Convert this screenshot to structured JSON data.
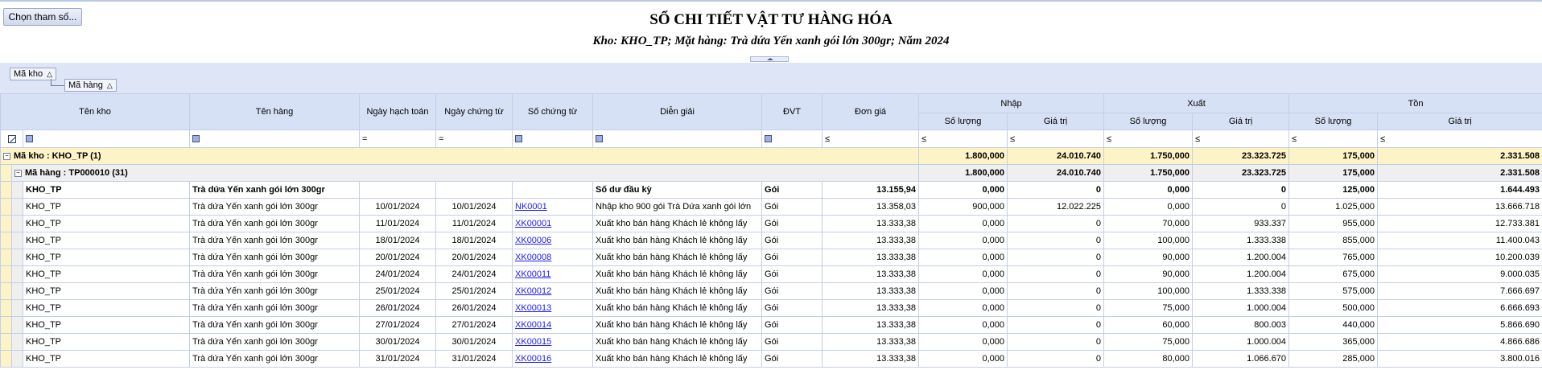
{
  "toolbar": {
    "choose_params_label": "Chọn tham số..."
  },
  "report": {
    "title": "SỔ CHI TIẾT VẬT TƯ HÀNG HÓA",
    "subtitle": "Kho: KHO_TP; Mặt hàng: Trà dứa Yến xanh gói lớn 300gr; Năm 2024"
  },
  "group_panel": {
    "chip1": "Mã kho",
    "chip2": "Mã hàng",
    "sort_icon": "sort-ascending-icon"
  },
  "columns": {
    "warehouse": "Tên kho",
    "item": "Tên hàng",
    "posting_date": "Ngày hạch toán",
    "voucher_date": "Ngày chứng từ",
    "voucher_no": "Số chứng từ",
    "description": "Diễn giải",
    "unit": "ĐVT",
    "unit_price": "Đơn giá",
    "in": "Nhập",
    "out": "Xuất",
    "stock": "Tồn",
    "qty": "Số lượng",
    "value": "Giá trị"
  },
  "filter_ops": {
    "eq": "=",
    "le": "≤"
  },
  "group_level1": {
    "label": "Mã kho : KHO_TP (1)",
    "in_qty": "1.800,000",
    "in_val": "24.010.740",
    "out_qty": "1.750,000",
    "out_val": "23.323.725",
    "stock_qty": "175,000",
    "stock_val": "2.331.508"
  },
  "group_level2": {
    "label": "Mã hàng : TP000010 (31)",
    "in_qty": "1.800,000",
    "in_val": "24.010.740",
    "out_qty": "1.750,000",
    "out_val": "23.323.725",
    "stock_qty": "175,000",
    "stock_val": "2.331.508"
  },
  "rows": [
    {
      "warehouse": "KHO_TP",
      "item": "Trà dứa Yến xanh gói lớn 300gr",
      "posting_date": "",
      "voucher_date": "",
      "voucher_no": "",
      "description": "Số dư đầu kỳ",
      "unit": "Gói",
      "unit_price": "13.155,94",
      "in_qty": "0,000",
      "in_val": "0",
      "out_qty": "0,000",
      "out_val": "0",
      "stock_qty": "125,000",
      "stock_val": "1.644.493"
    },
    {
      "warehouse": "KHO_TP",
      "item": "Trà dứa Yến xanh gói lớn 300gr",
      "posting_date": "10/01/2024",
      "voucher_date": "10/01/2024",
      "voucher_no": "NK0001",
      "description": "Nhập kho 900 gói Trà Dứa xanh gói lớn",
      "unit": "Gói",
      "unit_price": "13.358,03",
      "in_qty": "900,000",
      "in_val": "12.022.225",
      "out_qty": "0,000",
      "out_val": "0",
      "stock_qty": "1.025,000",
      "stock_val": "13.666.718"
    },
    {
      "warehouse": "KHO_TP",
      "item": "Trà dứa Yến xanh gói lớn 300gr",
      "posting_date": "11/01/2024",
      "voucher_date": "11/01/2024",
      "voucher_no": "XK00001",
      "description": "Xuất kho bán hàng Khách lẻ không lấy",
      "unit": "Gói",
      "unit_price": "13.333,38",
      "in_qty": "0,000",
      "in_val": "0",
      "out_qty": "70,000",
      "out_val": "933.337",
      "stock_qty": "955,000",
      "stock_val": "12.733.381"
    },
    {
      "warehouse": "KHO_TP",
      "item": "Trà dứa Yến xanh gói lớn 300gr",
      "posting_date": "18/01/2024",
      "voucher_date": "18/01/2024",
      "voucher_no": "XK00006",
      "description": "Xuất kho bán hàng Khách lẻ không lấy",
      "unit": "Gói",
      "unit_price": "13.333,38",
      "in_qty": "0,000",
      "in_val": "0",
      "out_qty": "100,000",
      "out_val": "1.333.338",
      "stock_qty": "855,000",
      "stock_val": "11.400.043"
    },
    {
      "warehouse": "KHO_TP",
      "item": "Trà dứa Yến xanh gói lớn 300gr",
      "posting_date": "20/01/2024",
      "voucher_date": "20/01/2024",
      "voucher_no": "XK00008",
      "description": "Xuất kho bán hàng Khách lẻ không lấy",
      "unit": "Gói",
      "unit_price": "13.333,38",
      "in_qty": "0,000",
      "in_val": "0",
      "out_qty": "90,000",
      "out_val": "1.200.004",
      "stock_qty": "765,000",
      "stock_val": "10.200.039"
    },
    {
      "warehouse": "KHO_TP",
      "item": "Trà dứa Yến xanh gói lớn 300gr",
      "posting_date": "24/01/2024",
      "voucher_date": "24/01/2024",
      "voucher_no": "XK00011",
      "description": "Xuất kho bán hàng Khách lẻ không lấy",
      "unit": "Gói",
      "unit_price": "13.333,38",
      "in_qty": "0,000",
      "in_val": "0",
      "out_qty": "90,000",
      "out_val": "1.200.004",
      "stock_qty": "675,000",
      "stock_val": "9.000.035"
    },
    {
      "warehouse": "KHO_TP",
      "item": "Trà dứa Yến xanh gói lớn 300gr",
      "posting_date": "25/01/2024",
      "voucher_date": "25/01/2024",
      "voucher_no": "XK00012",
      "description": "Xuất kho bán hàng Khách lẻ không lấy",
      "unit": "Gói",
      "unit_price": "13.333,38",
      "in_qty": "0,000",
      "in_val": "0",
      "out_qty": "100,000",
      "out_val": "1.333.338",
      "stock_qty": "575,000",
      "stock_val": "7.666.697"
    },
    {
      "warehouse": "KHO_TP",
      "item": "Trà dứa Yến xanh gói lớn 300gr",
      "posting_date": "26/01/2024",
      "voucher_date": "26/01/2024",
      "voucher_no": "XK00013",
      "description": "Xuất kho bán hàng Khách lẻ không lấy",
      "unit": "Gói",
      "unit_price": "13.333,38",
      "in_qty": "0,000",
      "in_val": "0",
      "out_qty": "75,000",
      "out_val": "1.000.004",
      "stock_qty": "500,000",
      "stock_val": "6.666.693"
    },
    {
      "warehouse": "KHO_TP",
      "item": "Trà dứa Yến xanh gói lớn 300gr",
      "posting_date": "27/01/2024",
      "voucher_date": "27/01/2024",
      "voucher_no": "XK00014",
      "description": "Xuất kho bán hàng Khách lẻ không lấy",
      "unit": "Gói",
      "unit_price": "13.333,38",
      "in_qty": "0,000",
      "in_val": "0",
      "out_qty": "60,000",
      "out_val": "800.003",
      "stock_qty": "440,000",
      "stock_val": "5.866.690"
    },
    {
      "warehouse": "KHO_TP",
      "item": "Trà dứa Yến xanh gói lớn 300gr",
      "posting_date": "30/01/2024",
      "voucher_date": "30/01/2024",
      "voucher_no": "XK00015",
      "description": "Xuất kho bán hàng Khách lẻ không lấy",
      "unit": "Gói",
      "unit_price": "13.333,38",
      "in_qty": "0,000",
      "in_val": "0",
      "out_qty": "75,000",
      "out_val": "1.000.004",
      "stock_qty": "365,000",
      "stock_val": "4.866.686"
    },
    {
      "warehouse": "KHO_TP",
      "item": "Trà dứa Yến xanh gói lớn 300gr",
      "posting_date": "31/01/2024",
      "voucher_date": "31/01/2024",
      "voucher_no": "XK00016",
      "description": "Xuất kho bán hàng Khách lẻ không lấy",
      "unit": "Gói",
      "unit_price": "13.333,38",
      "in_qty": "0,000",
      "in_val": "0",
      "out_qty": "80,000",
      "out_val": "1.066.670",
      "stock_qty": "285,000",
      "stock_val": "3.800.016"
    }
  ]
}
